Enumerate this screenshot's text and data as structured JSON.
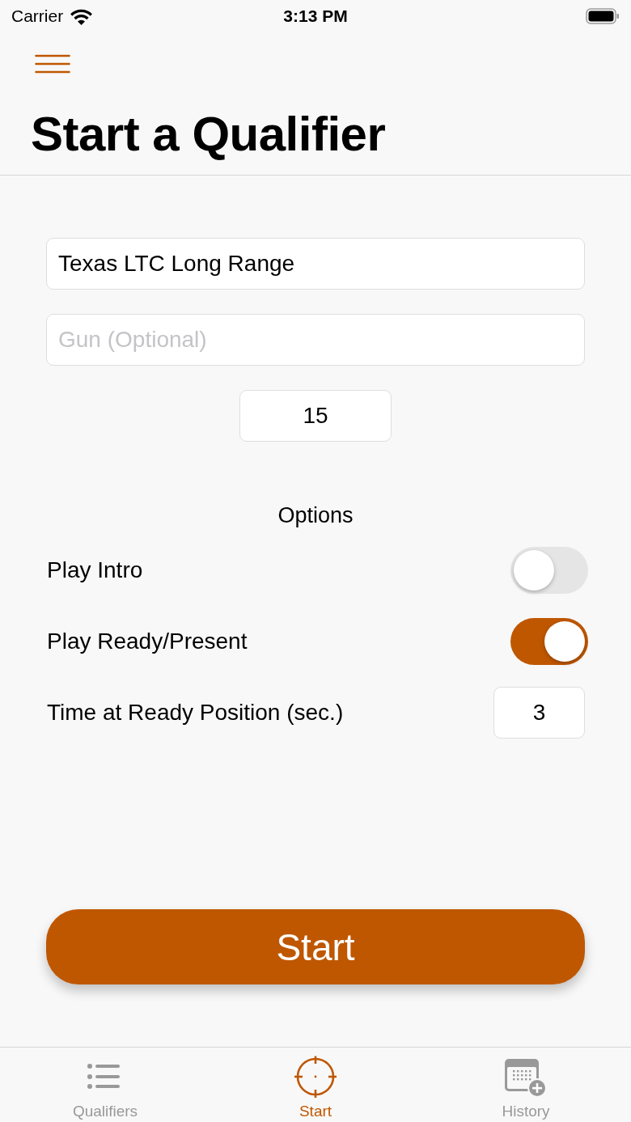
{
  "status_bar": {
    "carrier": "Carrier",
    "time": "3:13 PM"
  },
  "nav": {
    "title": "Start a Qualifier"
  },
  "form": {
    "qualifier_field": {
      "value": "Texas LTC Long Range"
    },
    "gun_field": {
      "placeholder": "Gun (Optional)"
    },
    "count_field": {
      "value": "15"
    }
  },
  "options": {
    "heading": "Options",
    "rows": [
      {
        "kind": "toggle",
        "label": "Play Intro",
        "on": false
      },
      {
        "kind": "toggle",
        "label": "Play Ready/Present",
        "on": true
      },
      {
        "kind": "number",
        "label": "Time at Ready Position (sec.)",
        "value": "3"
      }
    ]
  },
  "start_button": {
    "label": "Start"
  },
  "tab_bar": {
    "tabs": [
      {
        "kind": "list",
        "label": "Qualifiers",
        "selected": false
      },
      {
        "kind": "target",
        "label": "Start",
        "selected": true
      },
      {
        "kind": "calendar",
        "label": "History",
        "selected": false
      }
    ]
  }
}
